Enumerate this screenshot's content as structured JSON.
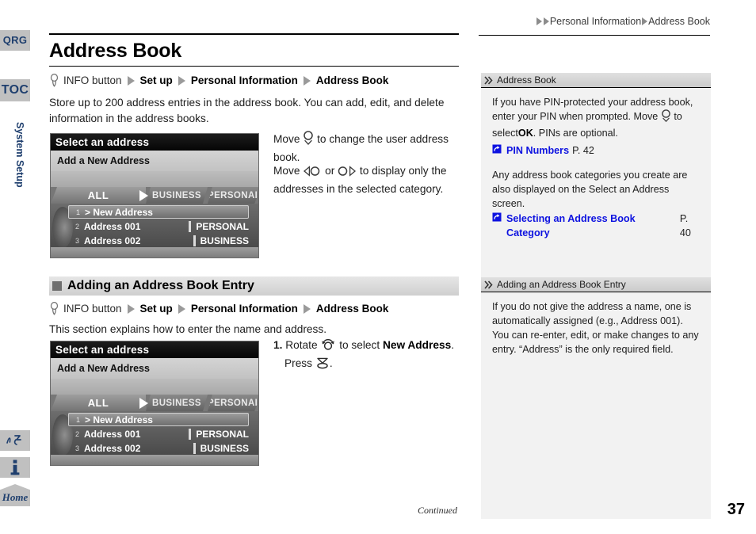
{
  "rail": {
    "qrg": "QRG",
    "toc": "TOC",
    "section_label": "System Setup",
    "voice_icon": "voice-command-icon",
    "info_icon": "information-icon",
    "home": "Home"
  },
  "top_breadcrumb": {
    "items": [
      "Personal Information",
      "Address Book"
    ]
  },
  "main": {
    "title": "Address Book",
    "nav_path_1": {
      "button_icon": "info-button-press-icon",
      "button_label": "INFO button",
      "steps": [
        "Set up",
        "Personal Information",
        "Address Book"
      ]
    },
    "intro": "Store up to 200 address entries in the address book. You can add, edit, and delete information in the address books.",
    "callout_1": {
      "before": "Move",
      "icon": "joystick-move-down-icon",
      "after": "to change the user address book."
    },
    "callout_2": {
      "before": "Move",
      "icon_left": "joystick-move-left-icon",
      "middle": "or",
      "icon_right": "joystick-move-right-icon",
      "after": "to display only the addresses in the selected category."
    },
    "section_heading": "Adding an Address Book Entry",
    "nav_path_2": {
      "button_icon": "info-button-press-icon",
      "button_label": "INFO button",
      "steps": [
        "Set up",
        "Personal Information",
        "Address Book"
      ]
    },
    "section_intro": "This section explains how to enter the name and address.",
    "step_1": {
      "number": "1.",
      "before": "Rotate",
      "rotate_icon": "rotate-knob-icon",
      "middle": "to select",
      "target": "New Address",
      "period": ".",
      "press_before": "Press",
      "press_icon": "press-knob-icon",
      "press_after": "."
    }
  },
  "nav_screen": {
    "title": "Select an address",
    "subtitle": "Add a New Address",
    "tabs": [
      "ALL",
      "BUSINESS",
      "PERSONAL"
    ],
    "selected_tab": "ALL",
    "rows": [
      {
        "index": "1",
        "name": "> New Address",
        "category": "",
        "selected": true
      },
      {
        "index": "2",
        "name": "Address 001",
        "category": "PERSONAL",
        "selected": false
      },
      {
        "index": "3",
        "name": "Address 002",
        "category": "BUSINESS",
        "selected": false
      }
    ]
  },
  "sidebar": {
    "box_1": {
      "header": "Address Book",
      "header_icon": "double-chevron-icon",
      "paragraph_1_a": "If you have PIN-protected your address book, enter your PIN when prompted. Move",
      "paragraph_1_icon": "joystick-move-down-icon",
      "paragraph_1_b": "to select",
      "paragraph_1_bold": "OK",
      "paragraph_1_c": ". PINs are optional.",
      "link_1": {
        "icon": "jump-to-page-icon",
        "label": "PIN Numbers",
        "page": "P. 42"
      },
      "paragraph_2": "Any address book categories you create are also displayed on the Select an Address screen.",
      "link_2": {
        "icon": "jump-to-page-icon",
        "label": "Selecting an Address Book Category",
        "page": "P. 40"
      }
    },
    "box_2": {
      "header": "Adding an Address Book Entry",
      "header_icon": "double-chevron-icon",
      "paragraph_1": "If you do not give the address a name, one is automatically assigned (e.g., Address 001). You can re-enter, edit, or make changes to any entry. “Address” is the only required field."
    }
  },
  "footer": {
    "continued": "Continued",
    "page_number": "37"
  },
  "colors": {
    "link": "#0d12e0",
    "rail_tab_bg": "#c0c0c0",
    "rail_text": "#1f3f6e",
    "sidebar_bg": "#f2f2f2",
    "heading_bar": "#d8d8d8"
  }
}
